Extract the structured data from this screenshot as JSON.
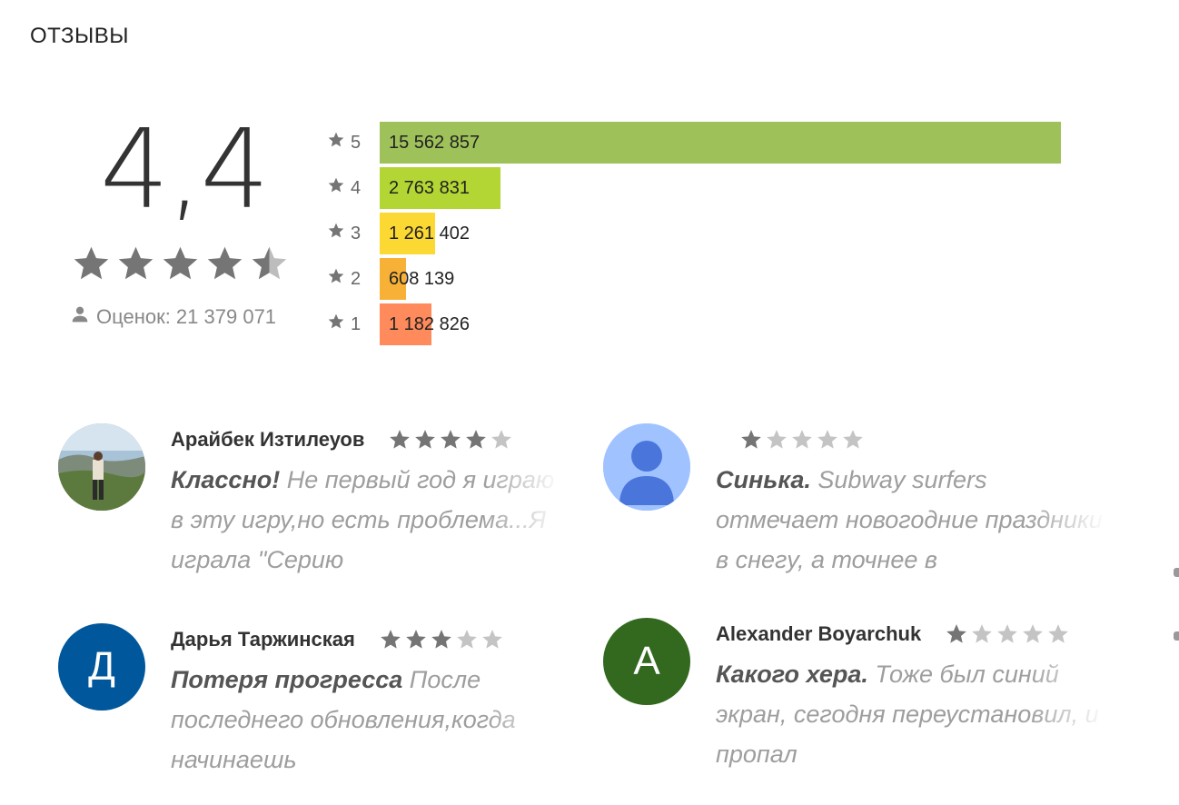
{
  "section_title": "ОТЗЫВЫ",
  "summary": {
    "score": "4,4",
    "stars": 4.5,
    "count_label": "Оценок: 21 379 071",
    "icons": {
      "person": "person-icon",
      "star": "star-icon"
    }
  },
  "histogram": [
    {
      "stars": "5",
      "value_text": "15 562 857",
      "value": 15562857,
      "color": "#9fc15a"
    },
    {
      "stars": "4",
      "value_text": "2 763 831",
      "value": 2763831,
      "color": "#b3d634"
    },
    {
      "stars": "3",
      "value_text": "1 261 402",
      "value": 1261402,
      "color": "#fcd832"
    },
    {
      "stars": "2",
      "value_text": "608 139",
      "value": 608139,
      "color": "#f7b137"
    },
    {
      "stars": "1",
      "value_text": "1 182 826",
      "value": 1182826,
      "color": "#ff8a5c"
    }
  ],
  "reviews": [
    {
      "author": "Арайбек Изтилеуов",
      "rating": 4,
      "title": "Классно!",
      "text": "Не первый год я играю в эту игру,но есть проблема...Я играла \"Серию",
      "avatar": {
        "type": "photo",
        "letter": "",
        "color": "#6b8c5a"
      }
    },
    {
      "author": "",
      "rating": 1,
      "title": "Синька.",
      "text": "Subway surfers отмечает новогодние праздники в снегу, а точнее в",
      "avatar": {
        "type": "default",
        "letter": "",
        "color": "#a0c3ff"
      }
    },
    {
      "author": "Дарья Таржинская",
      "rating": 3,
      "title": "Потеря прогресса",
      "text": "После последнего обновления,когда начинаешь",
      "avatar": {
        "type": "letter",
        "letter": "Д",
        "color": "#01579b"
      }
    },
    {
      "author": "Alexander Boyarchuk",
      "rating": 1,
      "title": "Какого хера.",
      "text": "Тоже был синий экран, сегодня переустановил, и пропал",
      "avatar": {
        "type": "letter",
        "letter": "A",
        "color": "#33691e"
      }
    }
  ]
}
